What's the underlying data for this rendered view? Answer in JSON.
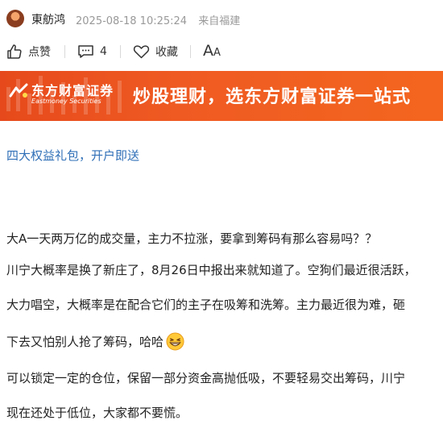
{
  "post": {
    "author": "東舫鸿",
    "datetime": "2025-08-18 10:25:24",
    "source": "来自福建"
  },
  "actions": {
    "like_label": "点赞",
    "comment_count": "4",
    "favorite_label": "收藏",
    "font_label": "A",
    "font_label_small": "A"
  },
  "banner": {
    "logo_cn": "东方财富证券",
    "logo_en": "Eastmoney Securities",
    "slogan": "炒股理财，选东方财富证券一站式"
  },
  "promo_link": "四大权益礼包，开户即送",
  "body": {
    "lines": [
      "大A一天两万亿的成交量，主力不拉涨，要拿到筹码有那么容易吗？？",
      "川宁大概率是换了新庄了，8月26日中报出来就知道了。空狗们最近很活跃，",
      "大力唱空，大概率是在配合它们的主子在吸筹和洗筹。主力最近很为难，砸",
      "下去又怕别人抢了筹码，哈哈",
      "可以锁定一定的仓位，保留一部分资金高抛低吸，不要轻易交出筹码，川宁",
      "现在还处于低位，大家都不要慌。"
    ],
    "emoji": "grin-emoji"
  },
  "colors": {
    "banner": "#ef5a22",
    "link": "#2f6fb7",
    "meta": "#999999"
  }
}
